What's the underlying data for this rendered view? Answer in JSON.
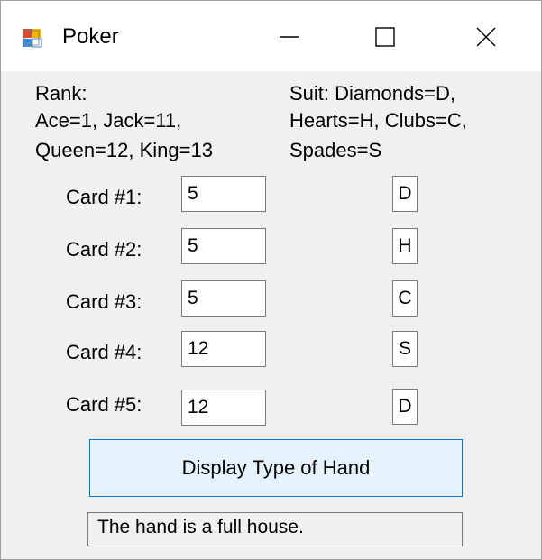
{
  "window": {
    "title": "Poker",
    "controls": {
      "minimize": "minimize-icon",
      "maximize": "maximize-icon",
      "close": "close-icon"
    }
  },
  "legend": {
    "rank_lines": [
      "Rank:",
      "Ace=1, Jack=11,",
      "Queen=12, King=13"
    ],
    "suit_lines": [
      "Suit:  Diamonds=D,",
      "Hearts=H, Clubs=C,",
      "Spades=S"
    ]
  },
  "cards": [
    {
      "label": "Card #1:",
      "rank": "5",
      "suit": "D"
    },
    {
      "label": "Card #2:",
      "rank": "5",
      "suit": "H"
    },
    {
      "label": "Card #3:",
      "rank": "5",
      "suit": "C"
    },
    {
      "label": "Card #4:",
      "rank": "12",
      "suit": "S"
    },
    {
      "label": "Card #5:",
      "rank": "12",
      "suit": "D"
    }
  ],
  "action": {
    "label": "Display Type of Hand"
  },
  "result": {
    "text": "The hand is a full house."
  },
  "colors": {
    "button_bg": "#e5f1fb",
    "button_border": "#0078d7",
    "window_bg": "#f0f0f0"
  }
}
